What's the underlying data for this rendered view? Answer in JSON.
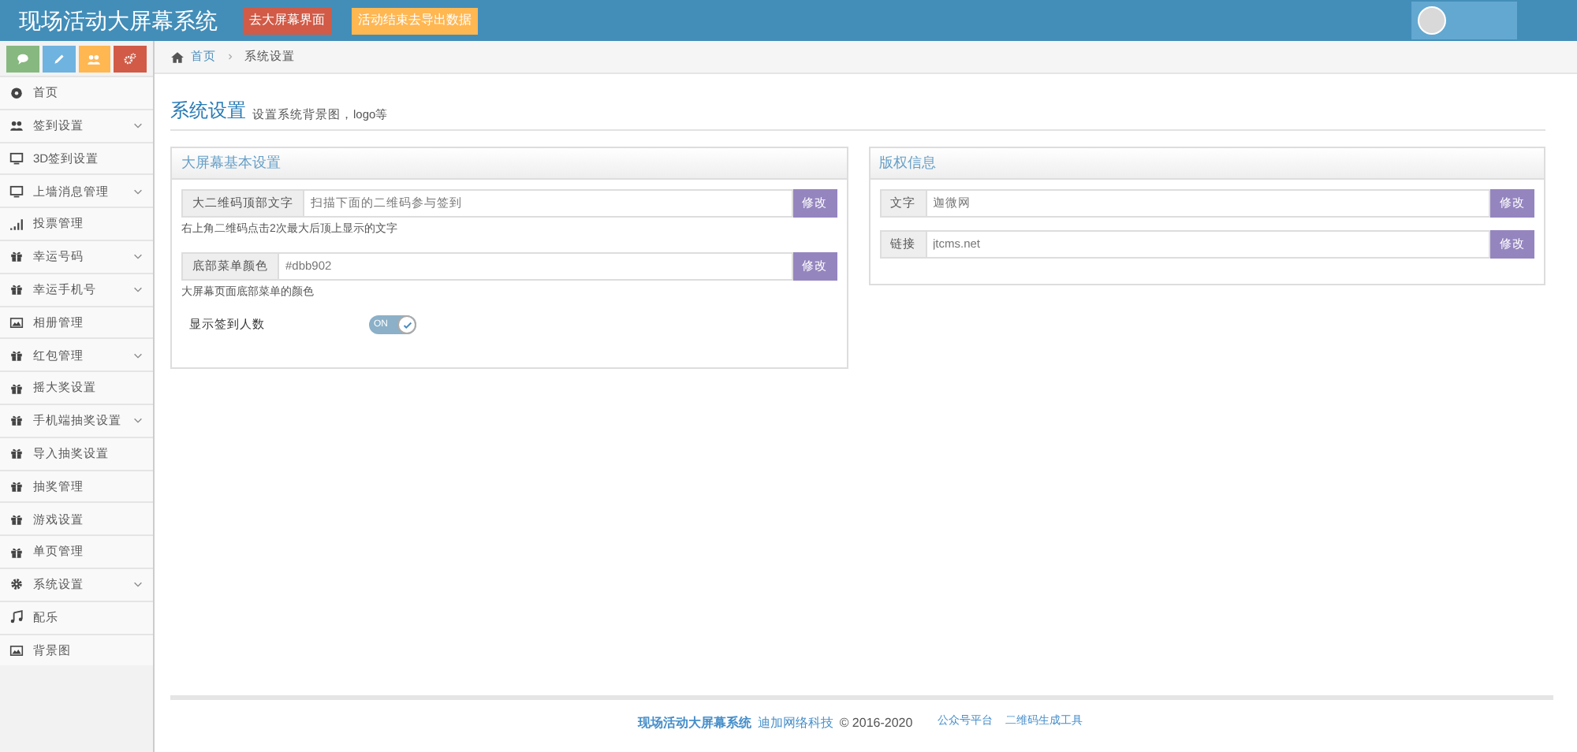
{
  "header": {
    "title": "现场活动大屏幕系统",
    "buttons": [
      {
        "label": "去大屏幕界面",
        "kind": "danger"
      },
      {
        "label": "活动结束去导出数据",
        "kind": "warning"
      }
    ]
  },
  "shortcuts": [
    {
      "kind": "comment",
      "color": "#87b87f"
    },
    {
      "kind": "pencil",
      "color": "#6fb3e0"
    },
    {
      "kind": "users",
      "color": "#ffb752"
    },
    {
      "kind": "cogs",
      "color": "#d15b47"
    }
  ],
  "sidebar": {
    "items": [
      {
        "label": "首页",
        "kind": "dashboard",
        "expandable": false
      },
      {
        "label": "签到设置",
        "kind": "users",
        "expandable": true
      },
      {
        "label": "3D签到设置",
        "kind": "monitor",
        "expandable": false
      },
      {
        "label": "上墙消息管理",
        "kind": "monitor",
        "expandable": true
      },
      {
        "label": "投票管理",
        "kind": "signal",
        "expandable": false
      },
      {
        "label": "幸运号码",
        "kind": "gift",
        "expandable": true
      },
      {
        "label": "幸运手机号",
        "kind": "gift",
        "expandable": true
      },
      {
        "label": "相册管理",
        "kind": "picture",
        "expandable": false
      },
      {
        "label": "红包管理",
        "kind": "gift",
        "expandable": true
      },
      {
        "label": "摇大奖设置",
        "kind": "gift",
        "expandable": false
      },
      {
        "label": "手机端抽奖设置",
        "kind": "gift",
        "expandable": true
      },
      {
        "label": "导入抽奖设置",
        "kind": "gift",
        "expandable": false
      },
      {
        "label": "抽奖管理",
        "kind": "gift",
        "expandable": false
      },
      {
        "label": "游戏设置",
        "kind": "gift",
        "expandable": false
      },
      {
        "label": "单页管理",
        "kind": "gift",
        "expandable": false
      },
      {
        "label": "系统设置",
        "kind": "gear",
        "expandable": true
      },
      {
        "label": "配乐",
        "kind": "music",
        "expandable": false
      },
      {
        "label": "背景图",
        "kind": "picture",
        "expandable": false
      }
    ]
  },
  "breadcrumb": [
    {
      "label": "首页",
      "link": true
    },
    {
      "label": "系统设置",
      "link": false
    }
  ],
  "page": {
    "title": "系统设置",
    "subtitle": "设置系统背景图，logo等"
  },
  "panels": [
    {
      "title": "大屏幕基本设置",
      "rows": [
        {
          "kind": "field",
          "label": "大二维码顶部文字",
          "value": "扫描下面的二维码参与签到",
          "button": "修改",
          "help": "右上角二维码点击2次最大后顶上显示的文字"
        },
        {
          "kind": "field",
          "label": "底部菜单颜色",
          "value": "#dbb902",
          "button": "修改",
          "help": "大屏幕页面底部菜单的颜色"
        },
        {
          "kind": "switch",
          "label": "显示签到人数",
          "on": true,
          "switch_text": "ON"
        }
      ]
    },
    {
      "title": "版权信息",
      "rows": [
        {
          "kind": "field",
          "label": "文字",
          "value": "迦微网",
          "button": "修改"
        },
        {
          "kind": "field",
          "label": "链接",
          "value": "jtcms.net",
          "button": "修改"
        }
      ]
    }
  ],
  "footer": {
    "brand": "现场活动大屏幕系统",
    "company": "迪加网络科技",
    "copyright": "© 2016-2020",
    "links": [
      "公众号平台",
      "二维码生成工具"
    ]
  }
}
